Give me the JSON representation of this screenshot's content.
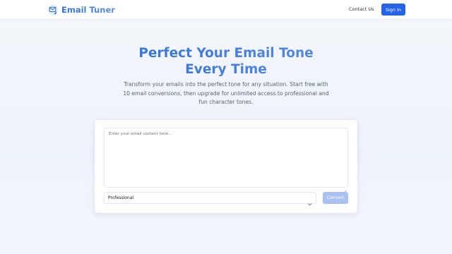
{
  "header": {
    "brand": "Email Tuner",
    "logo_icon": "envelope-music-icon",
    "nav": {
      "contact_label": "Contact Us",
      "signin_label": "Sign In"
    }
  },
  "hero": {
    "title_line1": "Perfect Your Email Tone",
    "title_line2": "Every Time",
    "subtitle_line1": "Transform your emails into the perfect tone for any situation. Start free with",
    "subtitle_line2": "10 email conversions, then upgrade for unlimited access to professional and",
    "subtitle_line3": "fun character tones."
  },
  "converter": {
    "input_placeholder": "Enter your email content here...",
    "input_value": "",
    "tone_selected": "Professional",
    "convert_label": "Convert"
  },
  "colors": {
    "accent": "#2563eb",
    "brand_gradient_start": "#2f6fd6",
    "brand_gradient_end": "#5b8fe3",
    "convert_disabled": "#a9c0f2"
  }
}
